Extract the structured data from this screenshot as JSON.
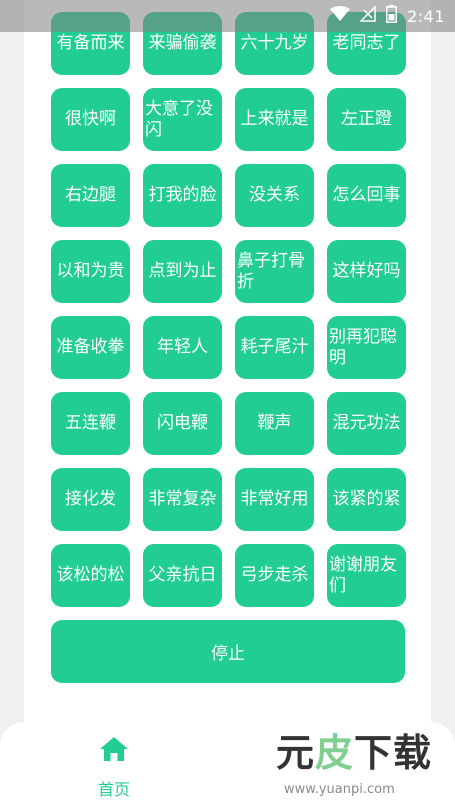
{
  "status_bar": {
    "time": "2:41",
    "icons": [
      "wifi-icon",
      "signal-off-icon",
      "battery-icon"
    ]
  },
  "buttons": [
    "有备而来",
    "来骗偷袭",
    "六十九岁",
    "老同志了",
    "很快啊",
    "大意了没闪",
    "上来就是",
    "左正蹬",
    "右边腿",
    "打我的脸",
    "没关系",
    "怎么回事",
    "以和为贵",
    "点到为止",
    "鼻子打骨折",
    "这样好吗",
    "准备收拳",
    "年轻人",
    "耗子尾汁",
    "别再犯聪明",
    "五连鞭",
    "闪电鞭",
    "鞭声",
    "混元功法",
    "接化发",
    "非常复杂",
    "非常好用",
    "该紧的紧",
    "该松的松",
    "父亲抗日",
    "弓步走杀",
    "谢谢朋友们"
  ],
  "stop_label": "停止",
  "nav": {
    "home_label": "首页"
  },
  "watermark": {
    "logo_dark": "元",
    "logo_light": "皮",
    "logo_dark2": "下载",
    "url": "www.yuanpi.com"
  },
  "colors": {
    "accent": "#22cd94",
    "background": "#eef1f0"
  }
}
